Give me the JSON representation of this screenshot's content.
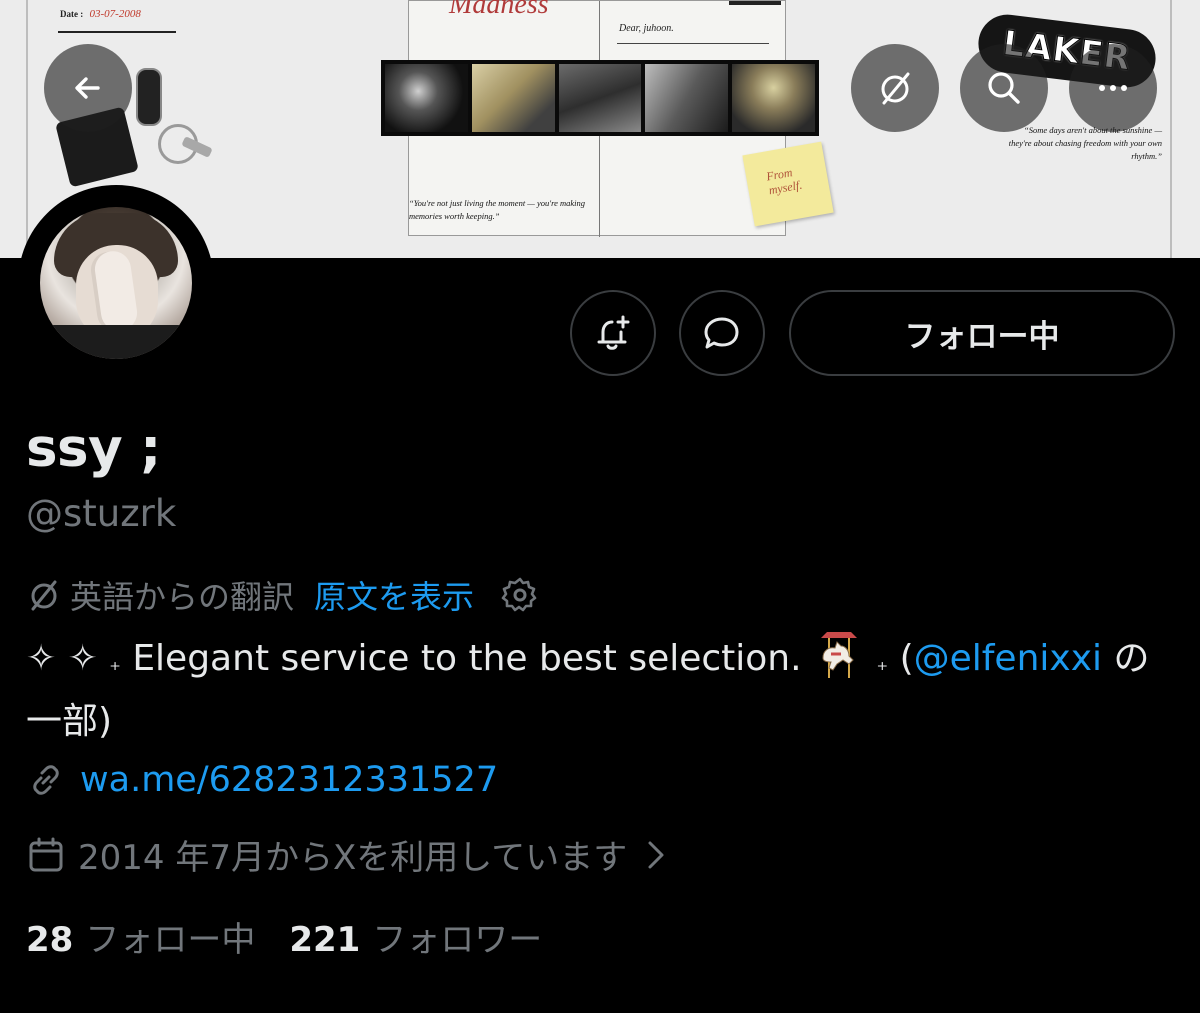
{
  "banner": {
    "date_label": "Date :",
    "date_value": "03-07-2008",
    "headline": "Madness",
    "letter_greeting": "Dear, juhoon.",
    "quote_left": "“You're not just living the moment — you're making memories worth keeping.”",
    "quote_right": "“Some days aren't about the sunshine — they're about chasing freedom with your own rhythm.”",
    "sticky_note": "From myself.",
    "skateboard_text": "LAKER"
  },
  "nav": {
    "back_icon": "arrow-left-icon",
    "translate_icon": "translate-slash-icon",
    "search_icon": "search-icon",
    "more_icon": "more-horizontal-icon"
  },
  "profile": {
    "display_name": "ssy ;",
    "handle": "@stuzrk",
    "translation_label": "英語からの翻訳",
    "show_original": "原文を表示",
    "bio_sparkles": "✧ ✧",
    "bio_plus": "₊",
    "bio_text": "Elegant service to the best selection.",
    "bio_open": "(",
    "bio_mention": "@elfenixxi",
    "bio_suffix": " の一部)",
    "link": "wa.me/6282312331527",
    "joined": "2014 年7月からXを利用しています"
  },
  "actions": {
    "notify_icon": "bell-plus-icon",
    "message_icon": "message-bubble-icon",
    "follow_label": "フォロー中"
  },
  "stats": {
    "following_count": "28",
    "following_label": "フォロー中",
    "followers_count": "221",
    "followers_label": "フォロワー"
  },
  "colors": {
    "background": "#000000",
    "text_primary": "#e7e9ea",
    "text_secondary": "#71767b",
    "accent_blue": "#1d9bf0",
    "button_border": "#3a3d40"
  }
}
